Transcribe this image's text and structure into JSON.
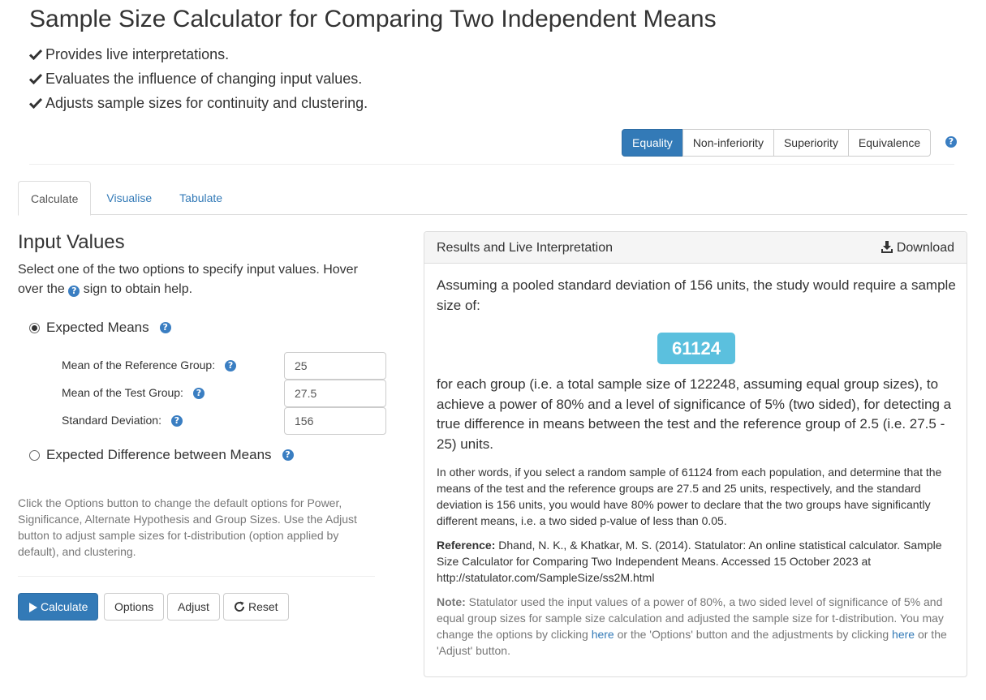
{
  "title": "Sample Size Calculator for Comparing Two Independent Means",
  "features": [
    "Provides live interpretations.",
    "Evaluates the influence of changing input values.",
    "Adjusts sample sizes for continuity and clustering."
  ],
  "hypothesis_buttons": [
    "Equality",
    "Non-inferiority",
    "Superiority",
    "Equivalence"
  ],
  "help_icon_glyph": "?",
  "tabs": [
    "Calculate",
    "Visualise",
    "Tabulate"
  ],
  "input": {
    "heading": "Input Values",
    "desc_before": "Select one of the two options to specify input values. Hover over the",
    "desc_after": "sign to obtain help.",
    "option_means": "Expected Means",
    "option_difference": "Expected Difference between Means",
    "fields": [
      {
        "label": "Mean of the Reference Group:",
        "value": "25"
      },
      {
        "label": "Mean of the Test Group:",
        "value": "27.5"
      },
      {
        "label": "Standard Deviation:",
        "value": "156"
      }
    ],
    "options_note": "Click the Options button to change the default options for Power, Significance, Alternate Hypothesis and Group Sizes. Use the Adjust button to adjust sample sizes for t-distribution (option applied by default), and clustering."
  },
  "actions": {
    "calculate": "Calculate",
    "options": "Options",
    "adjust": "Adjust",
    "reset": "Reset"
  },
  "results": {
    "panel_title": "Results and Live Interpretation",
    "download": "Download",
    "intro": "Assuming a pooled standard deviation of 156 units, the study would require a sample size of:",
    "sample_size": "61124",
    "main": "for each group (i.e. a total sample size of 122248, assuming equal group sizes), to achieve a power of 80% and a level of significance of 5% (two sided), for detecting a true difference in means between the test and the reference group of 2.5 (i.e. 27.5 - 25) units.",
    "other_words": "In other words, if you select a random sample of 61124 from each population, and determine that the means of the test and the reference groups are 27.5 and 25 units, respectively, and the standard deviation is 156 units, you would have 80% power to declare that the two groups have significantly different means, i.e. a two sided p-value of less than 0.05.",
    "reference_label": "Reference:",
    "reference": "Dhand, N. K., & Khatkar, M. S. (2014). Statulator: An online statistical calculator. Sample Size Calculator for Comparing Two Independent Means. Accessed 15 October 2023 at http://statulator.com/SampleSize/ss2M.html",
    "note_label": "Note:",
    "note_1": "Statulator used the input values of a power of 80%, a two sided level of significance of 5% and equal group sizes for sample size calculation and adjusted the sample size for t-distribution. You may change the options by clicking",
    "note_link_1": "here",
    "note_2": "or the 'Options' button and the adjustments by clicking",
    "note_link_2": "here",
    "note_3": "or the 'Adjust' button."
  },
  "colors": {
    "primary": "#337ab7",
    "badge": "#5bc0de",
    "muted": "#777777"
  },
  "icons": [
    "checkmark-icon",
    "question-circle-icon",
    "download-icon",
    "play-icon",
    "refresh-icon",
    "radio-icon"
  ]
}
